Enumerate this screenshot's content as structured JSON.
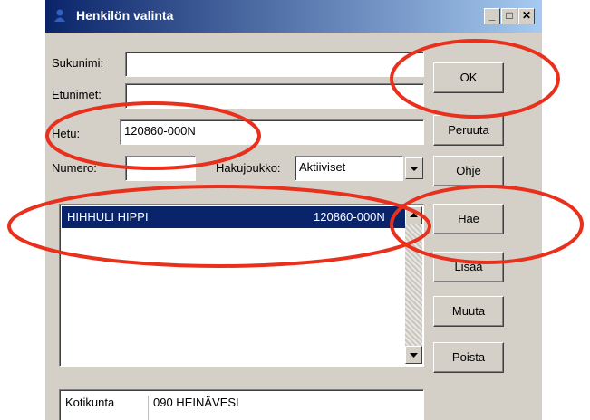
{
  "window": {
    "title": "Henkilön valinta",
    "controls": [
      "_",
      "□",
      "✕"
    ]
  },
  "form": {
    "sukunimi_label": "Sukunimi:",
    "sukunimi_value": "",
    "etunimet_label": "Etunimet:",
    "etunimet_value": "",
    "hetu_label": "Hetu:",
    "hetu_value": "120860-000N",
    "numero_label": "Numero:",
    "numero_value": "",
    "hakujoukko_label": "Hakujoukko:",
    "hakujoukko_value": "Aktiiviset"
  },
  "buttons": {
    "ok": "OK",
    "peruuta": "Peruuta",
    "ohje": "Ohje",
    "hae": "Hae",
    "lisaa": "Lisää",
    "muuta": "Muuta",
    "poista": "Poista"
  },
  "results": [
    {
      "name": "HIHHULI HIPPI",
      "hetu": "120860-000N",
      "selected": true
    }
  ],
  "details": {
    "kotikunta_label": "Kotikunta",
    "kotikunta_value": "090 HEINÄVESI"
  },
  "colors": {
    "title_gradient_start": "#0a246a",
    "title_gradient_end": "#a6caf0",
    "selection": "#0a246a",
    "dialog_face": "#d4d0c8",
    "annotation_ellipse": "#e8301c"
  },
  "icons": {
    "title": "person-icon",
    "dropdown": "chevron-down-icon",
    "scroll_up": "arrow-up-icon",
    "scroll_down": "arrow-down-icon"
  }
}
